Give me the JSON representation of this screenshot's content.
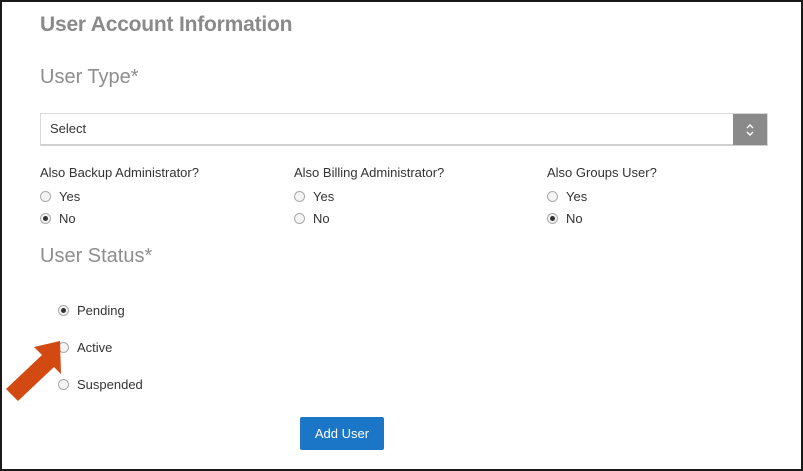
{
  "form": {
    "title": "User Account Information",
    "user_type": {
      "heading": "User Type*",
      "selected_value": "Select"
    },
    "questions": [
      {
        "label": "Also Backup Administrator?",
        "options": [
          "Yes",
          "No"
        ],
        "selected": "No"
      },
      {
        "label": "Also Billing Administrator?",
        "options": [
          "Yes",
          "No"
        ],
        "selected": "No"
      },
      {
        "label": "Also Groups User?",
        "options": [
          "Yes",
          "No"
        ],
        "selected": "No"
      }
    ],
    "user_status": {
      "heading": "User Status*",
      "options": [
        "Pending",
        "Active",
        "Suspended"
      ],
      "selected": "Pending"
    },
    "submit_label": "Add User"
  },
  "colors": {
    "heading": "#8a8a8a",
    "button": "#1b76c8",
    "annotation_arrow": "#d24a12"
  },
  "icons": {
    "select_arrows": "chevron-up-down-icon",
    "annotation": "arrow-pointer-icon"
  }
}
